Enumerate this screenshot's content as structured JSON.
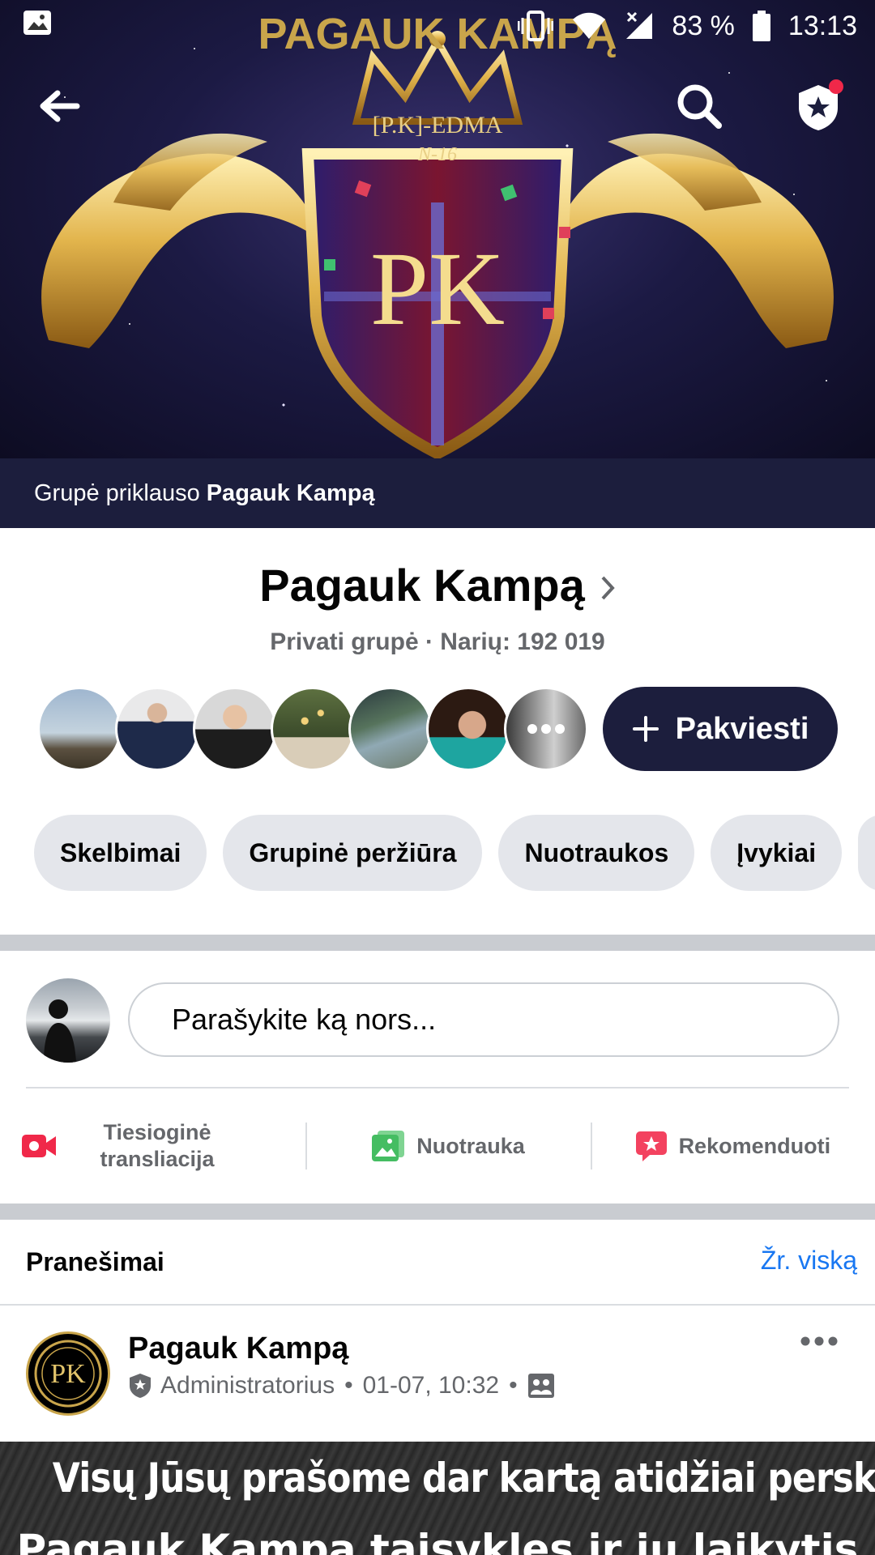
{
  "status_bar": {
    "battery": "83 %",
    "time": "13:13"
  },
  "cover": {
    "banner_title": "PAGAUK KAMPĄ",
    "emblem_text": "[P.K]-EDMA",
    "emblem_number": "N-16",
    "emblem_letters": "PK"
  },
  "owner_bar": {
    "prefix": "Grupė priklauso",
    "owner": "Pagauk Kampą"
  },
  "group": {
    "name": "Pagauk Kampą",
    "meta": "Privati grupė · Narių: 192 019",
    "invite_label": "Pakviesti"
  },
  "tabs": [
    "Skelbimai",
    "Grupinė peržiūra",
    "Nuotraukos",
    "Įvykiai"
  ],
  "composer": {
    "placeholder": "Parašykite ką nors...",
    "actions": {
      "live": "Tiesioginė transliacija",
      "photo": "Nuotrauka",
      "recommend": "Rekomenduoti"
    }
  },
  "announcements": {
    "title": "Pranešimai",
    "see_all": "Žr. viską",
    "post": {
      "author": "Pagauk Kampą",
      "role": "Administratorius",
      "timestamp": "01-07, 10:32",
      "image_line1": "Visų Jūsų prašome dar kartą atidžiai perskaityti",
      "image_line2": "Pagauk Kampą taisykles ir jų laikytis"
    }
  },
  "colors": {
    "brand_dark": "#1c1e3d",
    "link": "#1877f2",
    "chip": "#e4e6eb",
    "live_red": "#f02849",
    "photo_green": "#45bd62"
  }
}
